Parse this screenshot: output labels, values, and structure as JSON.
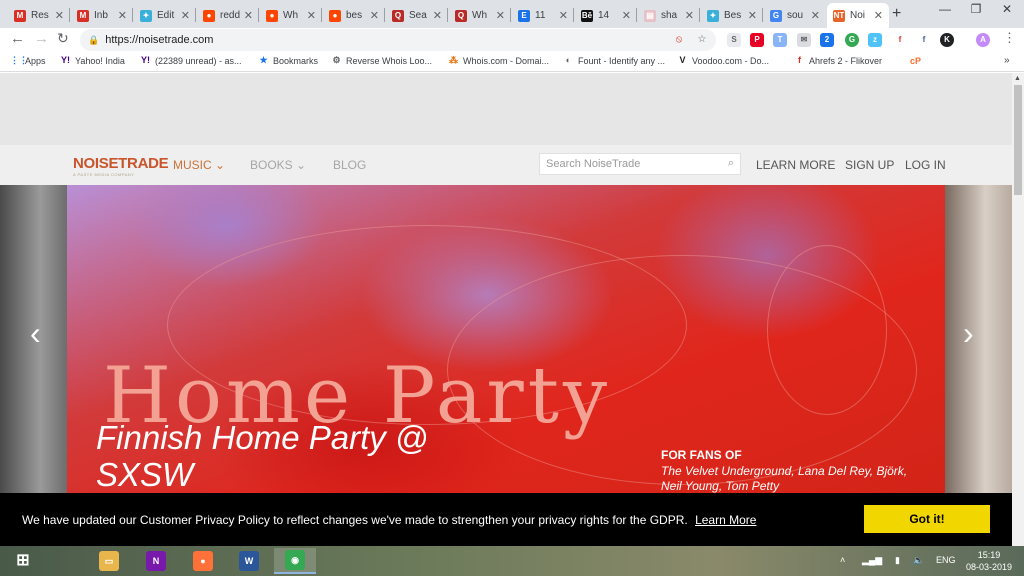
{
  "tabs": [
    {
      "label": "Res",
      "favicon": "gmail-icon",
      "color": "#d93025",
      "glyph": "M"
    },
    {
      "label": "Inb",
      "favicon": "gmail-icon",
      "color": "#d93025",
      "glyph": "M"
    },
    {
      "label": "Edit",
      "favicon": "star-icon",
      "color": "#3ab0d9",
      "glyph": "✦"
    },
    {
      "label": "redd",
      "favicon": "reddit-icon",
      "color": "#ff4500",
      "glyph": "●"
    },
    {
      "label": "Wh",
      "favicon": "reddit-icon",
      "color": "#ff4500",
      "glyph": "●"
    },
    {
      "label": "bes",
      "favicon": "reddit-icon",
      "color": "#ff4500",
      "glyph": "●"
    },
    {
      "label": "Sea",
      "favicon": "quora-icon",
      "color": "#b92b27",
      "glyph": "Q"
    },
    {
      "label": "Wh",
      "favicon": "quora-icon",
      "color": "#b92b27",
      "glyph": "Q"
    },
    {
      "label": "11",
      "favicon": "e-icon",
      "color": "#1a73e8",
      "glyph": "E"
    },
    {
      "label": "14",
      "favicon": "behance-icon",
      "color": "#111111",
      "glyph": "Bē"
    },
    {
      "label": "sha",
      "favicon": "image-icon",
      "color": "#e8c0c8",
      "glyph": "▤"
    },
    {
      "label": "Bes",
      "favicon": "star-icon",
      "color": "#3ab0d9",
      "glyph": "✦"
    },
    {
      "label": "sou",
      "favicon": "google-icon",
      "color": "#4285f4",
      "glyph": "G"
    },
    {
      "label": "Noi",
      "favicon": "noisetrade-icon",
      "color": "#e8642a",
      "glyph": "NT"
    }
  ],
  "window_controls": {
    "minimize": "—",
    "maximize": "❐",
    "close": "✕"
  },
  "address": {
    "url": "https://noisetrade.com"
  },
  "bookmarks": [
    {
      "label": "Apps",
      "icon": "apps-grid-icon",
      "glyph": "⋮⋮",
      "color": "#1a73e8"
    },
    {
      "label": "Yahoo! India",
      "icon": "yahoo-icon",
      "glyph": "Y!",
      "color": "#410093"
    },
    {
      "label": "(22389 unread) - as...",
      "icon": "yahoo-mail-icon",
      "glyph": "Y!",
      "color": "#410093"
    },
    {
      "label": "Bookmarks",
      "icon": "star-bookmark-icon",
      "glyph": "★",
      "color": "#1a73e8"
    },
    {
      "label": "Reverse Whois Loo...",
      "icon": "gear-icon",
      "glyph": "⚙",
      "color": "#5f6368"
    },
    {
      "label": "Whois.com - Domai...",
      "icon": "whois-icon",
      "glyph": "⁂",
      "color": "#e8710a"
    },
    {
      "label": "Fount - Identify any ...",
      "icon": "fount-icon",
      "glyph": "◐",
      "color": "#5f6368"
    },
    {
      "label": "Voodoo.com - Do...",
      "icon": "voodoo-icon",
      "glyph": "V",
      "color": "#202124"
    },
    {
      "label": "Ahrefs 2 - Flikover",
      "icon": "flikover-icon",
      "glyph": "f",
      "color": "#d93025"
    },
    {
      "label": "cP",
      "icon": "cpanel-icon",
      "glyph": "",
      "color": "#ff6c2c"
    }
  ],
  "site": {
    "logo": "NOISETRADE",
    "logo_sub": "A PASTE MEDIA COMPANY",
    "nav": {
      "music": "MUSIC",
      "books": "BOOKS",
      "blog": "BLOG"
    },
    "search_placeholder": "Search NoiseTrade",
    "right_nav": {
      "learn": "LEARN MORE",
      "signup": "SIGN UP",
      "login": "LOG IN"
    }
  },
  "hero": {
    "title_art": "Home Party",
    "feature_title": "Finnish Home Party @ SXSW",
    "fans_heading": "FOR FANS OF",
    "fans_list": "The Velvet Underground, Lana Del Rey, Björk, Neil Young, Tom Petty"
  },
  "cookie": {
    "text": "We have updated our Customer Privacy Policy to reflect changes we've made to strengthen your privacy rights for the GDPR.",
    "link": "Learn More",
    "button": "Got it!"
  },
  "taskbar": {
    "apps": [
      {
        "name": "start",
        "glyph": "⊞",
        "color": "transparent"
      },
      {
        "name": "file-explorer",
        "glyph": "▭",
        "color": "#e8b64a"
      },
      {
        "name": "onenote",
        "glyph": "N",
        "color": "#7719aa"
      },
      {
        "name": "firefox",
        "glyph": "●",
        "color": "#ff7139"
      },
      {
        "name": "word",
        "glyph": "W",
        "color": "#2b579a"
      },
      {
        "name": "chrome",
        "glyph": "◉",
        "color": "#34a853"
      }
    ],
    "lang": "ENG",
    "time": "15:19",
    "date": "08-03-2019"
  }
}
